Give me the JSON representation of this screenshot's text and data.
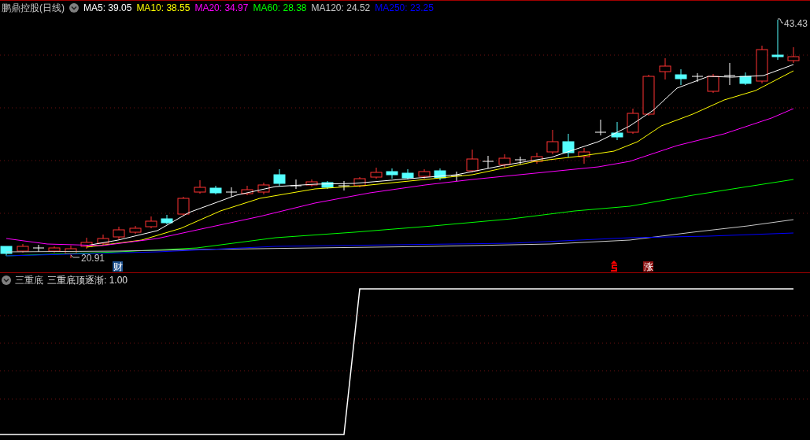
{
  "main_panel": {
    "title": "鹏鼎控股(日线)",
    "ma_legend": [
      {
        "label": "MA5: 39.05",
        "color": "#ffffff"
      },
      {
        "label": "MA10: 38.55",
        "color": "#ffff00"
      },
      {
        "label": "MA20: 34.97",
        "color": "#ff00ff"
      },
      {
        "label": "MA60: 28.38",
        "color": "#00ff00"
      },
      {
        "label": "MA120: 24.52",
        "color": "#c8c8c8"
      },
      {
        "label": "MA250: 23.25",
        "color": "#0000ff"
      }
    ],
    "high_label": "43.43",
    "low_label": "20.91",
    "event_markers": [
      {
        "kind": "text",
        "text": "财",
        "color": "#1c4f8c"
      },
      {
        "kind": "icon",
        "color": "#ff0000"
      },
      {
        "kind": "text",
        "text": "涨",
        "color": "#8b1010"
      }
    ]
  },
  "indicator_panel": {
    "title": "三重底",
    "value": "三重底顶逐渐: 1.00"
  }
}
